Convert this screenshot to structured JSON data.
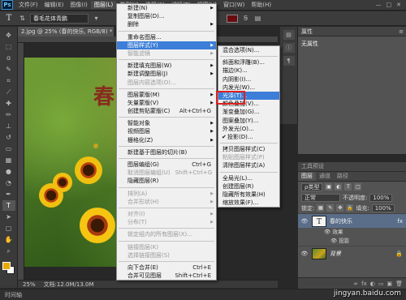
{
  "menubar": {
    "logo": "Ps",
    "items": [
      "文件(F)",
      "编辑(E)",
      "图像(I)",
      "图层(L)",
      "类型(Y)",
      "选择(S)",
      "滤镜(T)",
      "视图(V)",
      "窗口(W)",
      "帮助(H)"
    ],
    "active_index": 3,
    "window_controls": [
      "—",
      "□",
      "✕"
    ]
  },
  "options_bar": {
    "tool_glyph": "T",
    "font_family_value": "春毛花体青鹏",
    "text_color": "#6a0b10"
  },
  "document_tab": {
    "title": "2.jpg @ 25% (春的快乐, RGB/8) *",
    "close": "×"
  },
  "canvas": {
    "overlay_text": "春"
  },
  "status": {
    "zoom": "25%",
    "doc_size": "文档:12.0M/13.0M"
  },
  "timeline": {
    "label": "时间轴"
  },
  "layer_menu": {
    "items": [
      {
        "label": "新建(N)",
        "shortcut": "",
        "submenu": true,
        "disabled": false
      },
      {
        "label": "复制图层(D)...",
        "shortcut": "",
        "submenu": false,
        "disabled": false
      },
      {
        "label": "删除",
        "shortcut": "",
        "submenu": true,
        "disabled": false
      },
      {
        "sep": true
      },
      {
        "label": "重命名图层...",
        "shortcut": "",
        "submenu": false,
        "disabled": false
      },
      {
        "label": "图层样式(Y)",
        "shortcut": "",
        "submenu": true,
        "disabled": false,
        "highlight": true
      },
      {
        "label": "智能滤镜",
        "shortcut": "",
        "submenu": true,
        "disabled": true
      },
      {
        "sep": true
      },
      {
        "label": "新建填充图层(W)",
        "shortcut": "",
        "submenu": true,
        "disabled": false
      },
      {
        "label": "新建调整图层(J)",
        "shortcut": "",
        "submenu": true,
        "disabled": false
      },
      {
        "label": "图层内容选项(O)...",
        "shortcut": "",
        "submenu": false,
        "disabled": true
      },
      {
        "sep": true
      },
      {
        "label": "图层蒙版(M)",
        "shortcut": "",
        "submenu": true,
        "disabled": false
      },
      {
        "label": "矢量蒙版(V)",
        "shortcut": "",
        "submenu": true,
        "disabled": false
      },
      {
        "label": "创建剪贴蒙版(C)",
        "shortcut": "Alt+Ctrl+G",
        "submenu": false,
        "disabled": false
      },
      {
        "sep": true
      },
      {
        "label": "智能对象",
        "shortcut": "",
        "submenu": true,
        "disabled": false
      },
      {
        "label": "视频图层",
        "shortcut": "",
        "submenu": true,
        "disabled": false
      },
      {
        "label": "栅格化(Z)",
        "shortcut": "",
        "submenu": true,
        "disabled": false
      },
      {
        "sep": true
      },
      {
        "label": "新建基于图层的切片(B)",
        "shortcut": "",
        "submenu": false,
        "disabled": false
      },
      {
        "sep": true
      },
      {
        "label": "图层编组(G)",
        "shortcut": "Ctrl+G",
        "submenu": false,
        "disabled": false
      },
      {
        "label": "取消图层编组(U)",
        "shortcut": "Shift+Ctrl+G",
        "submenu": false,
        "disabled": true
      },
      {
        "label": "隐藏图层(R)",
        "shortcut": "",
        "submenu": false,
        "disabled": false
      },
      {
        "sep": true
      },
      {
        "label": "排列(A)",
        "shortcut": "",
        "submenu": true,
        "disabled": true
      },
      {
        "label": "合并形状(H)",
        "shortcut": "",
        "submenu": true,
        "disabled": true
      },
      {
        "sep": true
      },
      {
        "label": "对齐(I)",
        "shortcut": "",
        "submenu": true,
        "disabled": true
      },
      {
        "label": "分布(T)",
        "shortcut": "",
        "submenu": true,
        "disabled": true
      },
      {
        "sep": true
      },
      {
        "label": "锁定组内的所有图层(X)...",
        "shortcut": "",
        "submenu": false,
        "disabled": true
      },
      {
        "sep": true
      },
      {
        "label": "链接图层(K)",
        "shortcut": "",
        "submenu": false,
        "disabled": true
      },
      {
        "label": "选择链接图层(S)",
        "shortcut": "",
        "submenu": false,
        "disabled": true
      },
      {
        "sep": true
      },
      {
        "label": "向下合并(E)",
        "shortcut": "Ctrl+E",
        "submenu": false,
        "disabled": false
      },
      {
        "label": "合并可见图层",
        "shortcut": "Shift+Ctrl+E",
        "submenu": false,
        "disabled": false
      }
    ]
  },
  "style_submenu": {
    "items": [
      {
        "label": "混合选项(N)...",
        "disabled": false
      },
      {
        "sep": true
      },
      {
        "label": "斜面和浮雕(B)...",
        "disabled": false
      },
      {
        "label": "描边(K)...",
        "disabled": false
      },
      {
        "label": "内阴影(I)...",
        "disabled": false
      },
      {
        "label": "内发光(W)...",
        "disabled": false
      },
      {
        "label": "光泽(T)...",
        "disabled": false,
        "highlight": true
      },
      {
        "label": "颜色叠加(V)...",
        "disabled": false
      },
      {
        "label": "渐变叠加(G)...",
        "disabled": false
      },
      {
        "label": "图案叠加(Y)...",
        "disabled": false
      },
      {
        "label": "外发光(O)...",
        "disabled": false
      },
      {
        "label": "投影(D)...",
        "disabled": false,
        "checked": true
      },
      {
        "sep": true
      },
      {
        "label": "拷贝图层样式(C)",
        "disabled": false
      },
      {
        "label": "粘贴图层样式(P)",
        "disabled": true
      },
      {
        "label": "清除图层样式(A)",
        "disabled": false
      },
      {
        "sep": true
      },
      {
        "label": "全局光(L)...",
        "disabled": false
      },
      {
        "label": "创建图层(R)",
        "disabled": false
      },
      {
        "label": "隐藏所有效果(H)",
        "disabled": false
      },
      {
        "label": "缩放效果(F)...",
        "disabled": false
      }
    ]
  },
  "properties_panel": {
    "title": "属性",
    "value": "无属性"
  },
  "layers_panel": {
    "title": "工具预设",
    "tabs": [
      "图层",
      "通道",
      "路径"
    ],
    "kind_label": "ρ类型",
    "blend_mode": "正常",
    "opacity_label": "不透明度:",
    "opacity_value": "100%",
    "lock_label": "锁定:",
    "fill_label": "填充:",
    "fill_value": "100%",
    "layers": [
      {
        "name": "春的快乐",
        "thumb": "T",
        "fx": "fx",
        "effects_label": "效果",
        "effects": [
          "投影"
        ]
      },
      {
        "name": "背景",
        "thumb": "",
        "lock": "🔒"
      }
    ],
    "footer_icons": [
      "∞",
      "fx",
      "◐",
      "▭",
      "▣",
      "🗑"
    ]
  },
  "credit": {
    "text": "jingyan.baidu.com"
  }
}
